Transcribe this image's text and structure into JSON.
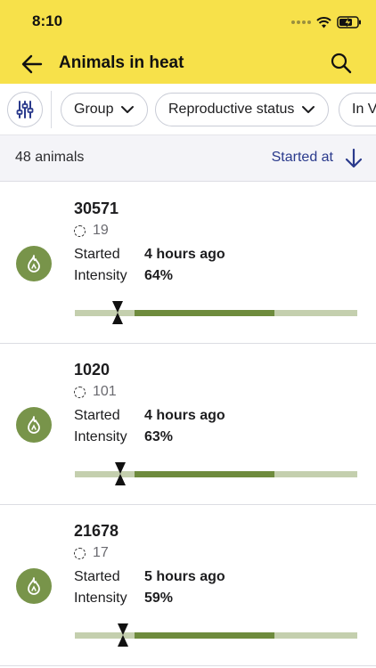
{
  "status_bar": {
    "time": "8:10",
    "battery_icon": "battery-charging-icon",
    "wifi_icon": "wifi-icon"
  },
  "app_bar": {
    "title": "Animals in heat",
    "back_icon": "arrow-left-icon",
    "search_icon": "search-icon",
    "color": "#f7e14a"
  },
  "filters": {
    "filter_icon": "sliders-icon",
    "chips": [
      {
        "label": "Group"
      },
      {
        "label": "Reproductive status"
      },
      {
        "label": "In V"
      }
    ]
  },
  "summary": {
    "count": "48 animals",
    "sort_label": "Started at",
    "sort_icon": "arrow-down-icon"
  },
  "accent_colors": {
    "avatar": "#78944a",
    "timeline_fill": "#6e8b3d",
    "timeline_track": "#c4cfae",
    "sort_link": "#2a3a8c"
  },
  "animals": [
    {
      "id": "30571",
      "group": "19",
      "started_label": "Started",
      "started": "4 hours ago",
      "intensity_label": "Intensity",
      "intensity": "64%",
      "marker": 0.15,
      "fill_start": 0.21,
      "fill_end": 0.707
    },
    {
      "id": "1020",
      "group": "101",
      "started_label": "Started",
      "started": "4 hours ago",
      "intensity_label": "Intensity",
      "intensity": "63%",
      "marker": 0.16,
      "fill_start": 0.21,
      "fill_end": 0.707
    },
    {
      "id": "21678",
      "group": "17",
      "started_label": "Started",
      "started": "5 hours ago",
      "intensity_label": "Intensity",
      "intensity": "59%",
      "marker": 0.17,
      "fill_start": 0.21,
      "fill_end": 0.707
    }
  ]
}
